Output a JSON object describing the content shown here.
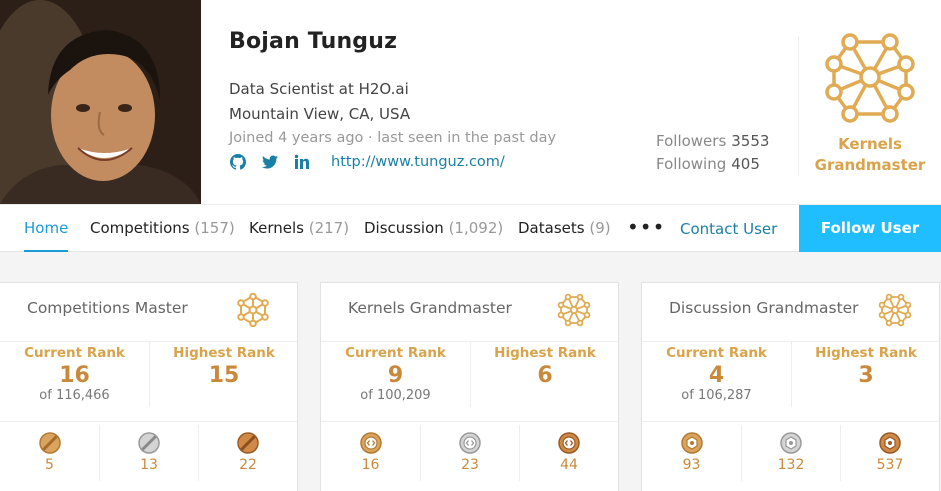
{
  "profile": {
    "name": "Bojan Tunguz",
    "occupation": "Data Scientist at H2O.ai",
    "location": "Mountain View, CA, USA",
    "joined": "Joined 4 years ago · last seen in the past day",
    "website": "http://www.tunguz.com/",
    "social_icons": [
      "github-icon",
      "twitter-icon",
      "linkedin-icon"
    ],
    "followers_label": "Followers",
    "followers_count": "3553",
    "following_label": "Following",
    "following_count": "405",
    "tier_line1": "Kernels",
    "tier_line2": "Grandmaster"
  },
  "nav": {
    "home": "Home",
    "competitions": "Competitions",
    "competitions_count": "(157)",
    "kernels": "Kernels",
    "kernels_count": "(217)",
    "discussion": "Discussion",
    "discussion_count": "(1,092)",
    "datasets": "Datasets",
    "datasets_count": "(9)",
    "more": "•••",
    "contact": "Contact User",
    "follow": "Follow User"
  },
  "cards": [
    {
      "title": "Competitions Master",
      "current_rank_label": "Current Rank",
      "current_rank": "16",
      "of_total": "of 116,466",
      "highest_rank_label": "Highest Rank",
      "highest_rank": "15",
      "medals": [
        {
          "type": "gold",
          "count": "5"
        },
        {
          "type": "silver",
          "count": "13"
        },
        {
          "type": "bronze",
          "count": "22"
        }
      ]
    },
    {
      "title": "Kernels Grandmaster",
      "current_rank_label": "Current Rank",
      "current_rank": "9",
      "of_total": "of 100,209",
      "highest_rank_label": "Highest Rank",
      "highest_rank": "6",
      "medals": [
        {
          "type": "gold",
          "count": "16"
        },
        {
          "type": "silver",
          "count": "23"
        },
        {
          "type": "bronze",
          "count": "44"
        }
      ]
    },
    {
      "title": "Discussion Grandmaster",
      "current_rank_label": "Current Rank",
      "current_rank": "4",
      "of_total": "of 106,287",
      "highest_rank_label": "Highest Rank",
      "highest_rank": "3",
      "medals": [
        {
          "type": "gold",
          "count": "93"
        },
        {
          "type": "silver",
          "count": "132"
        },
        {
          "type": "bronze",
          "count": "537"
        }
      ]
    }
  ],
  "colors": {
    "accent_blue": "#20beff",
    "link_blue": "#1a7fa6",
    "tier_gold": "#d8a34a",
    "rank_orange": "#c9893a"
  }
}
